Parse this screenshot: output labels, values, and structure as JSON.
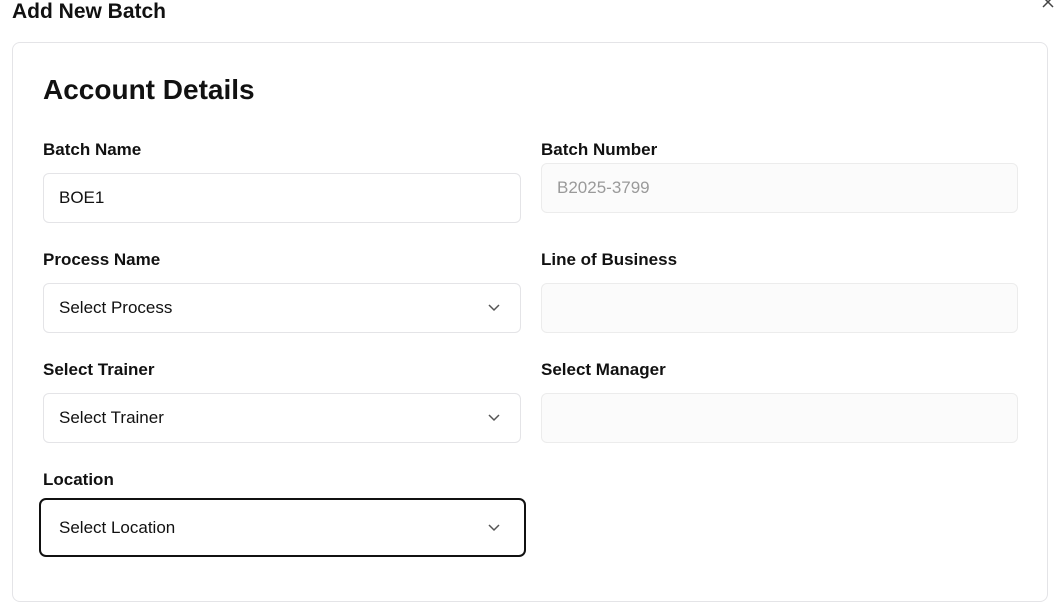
{
  "dialog": {
    "title": "Add New Batch",
    "close_icon": "close-icon"
  },
  "section": {
    "title": "Account Details"
  },
  "fields": {
    "batch_name": {
      "label": "Batch Name",
      "value": "BOE1"
    },
    "batch_number": {
      "label": "Batch Number",
      "placeholder": "B2025-3799"
    },
    "process_name": {
      "label": "Process Name",
      "value": "Select Process",
      "icon": "chevron-down-icon"
    },
    "line_of_business": {
      "label": "Line of Business",
      "value": ""
    },
    "trainer": {
      "label": "Select Trainer",
      "value": "Select Trainer",
      "icon": "chevron-down-icon"
    },
    "manager": {
      "label": "Select Manager",
      "value": ""
    },
    "location": {
      "label": "Location",
      "value": "Select Location",
      "icon": "chevron-down-icon"
    }
  },
  "colors": {
    "border": "#e4e4e7",
    "focus_border": "#111111",
    "placeholder_text": "#9a9a9a"
  }
}
